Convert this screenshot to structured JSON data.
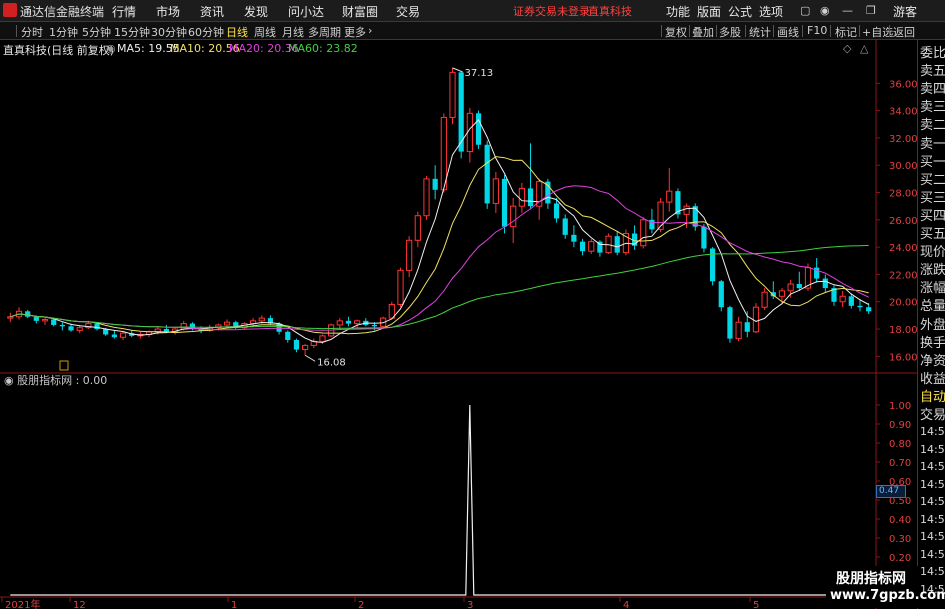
{
  "app": {
    "title": "通达信金融终端"
  },
  "menu": {
    "items": [
      "行情",
      "市场",
      "资讯",
      "发现",
      "问小达",
      "财富圈",
      "交易"
    ],
    "notice": "证券交易未登录",
    "stock_name": "直真科技",
    "right_items": [
      "功能",
      "版面",
      "公式",
      "选项"
    ],
    "guest": "游客"
  },
  "toolbar": {
    "periods": [
      "分时",
      "1分钟",
      "5分钟",
      "15分钟",
      "30分钟",
      "60分钟",
      "日线",
      "周线",
      "月线",
      "多周期",
      "更多"
    ],
    "active_period": "日线",
    "tools": [
      "复权",
      "叠加",
      "多股",
      "统计",
      "画线",
      "F10",
      "标记",
      "+自选",
      "返回"
    ]
  },
  "info": {
    "stock_label": "直真科技(日线 前复权)",
    "ma5": "MA5: 19.55",
    "ma10": "MA10: 20.56",
    "ma20": "MA20: 20.36",
    "ma60": "MA60: 23.82"
  },
  "colors": {
    "up": "#ff3333",
    "down": "#00d8e8",
    "ma5": "#f0f0f0",
    "ma10": "#f0e060",
    "ma20": "#e040e0",
    "ma60": "#40d040",
    "grid": "#8a1515"
  },
  "indicator": {
    "label": "股朋指标网 : 0.00",
    "current_value": "0.47"
  },
  "right_panel": {
    "items": [
      "委比",
      "卖五",
      "卖四",
      "卖三",
      "卖二",
      "卖一",
      "买一",
      "买二",
      "买三",
      "买四",
      "买五",
      "现价",
      "涨跌",
      "涨幅",
      "总量",
      "外盘",
      "换手",
      "净资",
      "收益"
    ],
    "auto": "自动",
    "trade": "交易",
    "times": [
      "14:56",
      "14:56",
      "14:56",
      "14:56",
      "14:56",
      "14:56",
      "14:56",
      "14:56",
      "14:56",
      "14:56"
    ]
  },
  "watermark": {
    "line1": "股朋指标网",
    "line2": "www.7gpzb.com"
  },
  "chart_data": [
    {
      "type": "candlestick",
      "title": "直真科技(日线 前复权)",
      "ylim": [
        15.0,
        38.0
      ],
      "y_ticks": [
        "36.00",
        "34.00",
        "32.00",
        "30.00",
        "28.00",
        "26.00",
        "24.00",
        "22.00",
        "20.00",
        "18.00",
        "16.00"
      ],
      "x_ticks": [
        "2021年",
        "12",
        "1",
        "2",
        "3",
        "4",
        "5"
      ],
      "annotations": {
        "high": "37.13",
        "low": "16.08"
      },
      "candles": [
        [
          18.8,
          19.2,
          18.5,
          18.9
        ],
        [
          18.9,
          19.6,
          18.7,
          19.3
        ],
        [
          19.3,
          19.4,
          18.8,
          18.9
        ],
        [
          18.9,
          19.0,
          18.4,
          18.6
        ],
        [
          18.6,
          18.9,
          18.3,
          18.7
        ],
        [
          18.7,
          18.8,
          18.2,
          18.3
        ],
        [
          18.3,
          18.5,
          17.9,
          18.2
        ],
        [
          18.2,
          18.4,
          17.8,
          17.9
        ],
        [
          17.9,
          18.3,
          17.7,
          18.1
        ],
        [
          18.1,
          18.6,
          18.0,
          18.4
        ],
        [
          18.4,
          18.5,
          17.9,
          18.0
        ],
        [
          18.0,
          18.1,
          17.5,
          17.6
        ],
        [
          17.6,
          17.9,
          17.3,
          17.4
        ],
        [
          17.4,
          17.8,
          17.2,
          17.7
        ],
        [
          17.7,
          17.9,
          17.4,
          17.5
        ],
        [
          17.5,
          17.8,
          17.3,
          17.6
        ],
        [
          17.6,
          17.9,
          17.4,
          17.8
        ],
        [
          17.8,
          18.2,
          17.6,
          18.0
        ],
        [
          18.0,
          18.3,
          17.7,
          17.8
        ],
        [
          17.8,
          18.1,
          17.6,
          18.0
        ],
        [
          18.0,
          18.6,
          17.9,
          18.4
        ],
        [
          18.4,
          18.5,
          17.9,
          18.0
        ],
        [
          18.0,
          18.2,
          17.7,
          17.9
        ],
        [
          17.9,
          18.3,
          17.8,
          18.1
        ],
        [
          18.1,
          18.4,
          17.9,
          18.3
        ],
        [
          18.3,
          18.7,
          18.1,
          18.5
        ],
        [
          18.5,
          18.6,
          18.0,
          18.1
        ],
        [
          18.1,
          18.5,
          18.0,
          18.4
        ],
        [
          18.4,
          18.8,
          18.2,
          18.6
        ],
        [
          18.6,
          19.0,
          18.4,
          18.8
        ],
        [
          18.8,
          19.0,
          18.3,
          18.4
        ],
        [
          18.4,
          18.5,
          17.6,
          17.8
        ],
        [
          17.8,
          17.9,
          17.0,
          17.2
        ],
        [
          17.2,
          17.3,
          16.3,
          16.5
        ],
        [
          16.5,
          16.9,
          16.08,
          16.8
        ],
        [
          16.8,
          17.3,
          16.6,
          17.1
        ],
        [
          17.1,
          17.6,
          16.9,
          17.5
        ],
        [
          17.5,
          18.4,
          17.4,
          18.3
        ],
        [
          18.3,
          18.8,
          18.0,
          18.6
        ],
        [
          18.6,
          18.9,
          18.2,
          18.4
        ],
        [
          18.4,
          18.7,
          18.1,
          18.6
        ],
        [
          18.6,
          18.8,
          18.2,
          18.3
        ],
        [
          18.3,
          18.5,
          17.9,
          18.2
        ],
        [
          18.2,
          18.9,
          18.1,
          18.8
        ],
        [
          18.8,
          20.0,
          18.7,
          19.8
        ],
        [
          19.8,
          22.5,
          19.6,
          22.3
        ],
        [
          22.3,
          24.8,
          21.8,
          24.5
        ],
        [
          24.5,
          26.6,
          24.0,
          26.3
        ],
        [
          26.3,
          29.2,
          26.0,
          29.0
        ],
        [
          29.0,
          30.0,
          27.5,
          28.2
        ],
        [
          28.2,
          33.8,
          28.0,
          33.5
        ],
        [
          33.5,
          37.13,
          33.0,
          36.8
        ],
        [
          36.8,
          36.9,
          30.5,
          31.0
        ],
        [
          31.0,
          34.2,
          30.2,
          33.8
        ],
        [
          33.8,
          34.0,
          31.2,
          31.5
        ],
        [
          31.5,
          31.8,
          26.8,
          27.2
        ],
        [
          27.2,
          29.5,
          26.5,
          29.0
        ],
        [
          29.0,
          29.3,
          25.0,
          25.5
        ],
        [
          25.5,
          27.6,
          24.3,
          27.0
        ],
        [
          27.0,
          28.7,
          26.5,
          28.3
        ],
        [
          28.3,
          31.6,
          26.8,
          27.0
        ],
        [
          27.0,
          29.0,
          26.0,
          28.8
        ],
        [
          28.8,
          29.0,
          26.8,
          27.2
        ],
        [
          27.2,
          27.6,
          25.8,
          26.1
        ],
        [
          26.1,
          26.4,
          24.6,
          24.9
        ],
        [
          24.9,
          25.6,
          24.0,
          24.4
        ],
        [
          24.4,
          24.6,
          23.4,
          23.7
        ],
        [
          23.7,
          24.6,
          23.5,
          24.4
        ],
        [
          24.4,
          24.5,
          23.3,
          23.6
        ],
        [
          23.6,
          25.0,
          23.5,
          24.8
        ],
        [
          24.8,
          25.2,
          23.4,
          23.6
        ],
        [
          23.6,
          25.3,
          23.4,
          25.0
        ],
        [
          25.0,
          25.6,
          23.8,
          24.1
        ],
        [
          24.1,
          26.2,
          23.9,
          26.0
        ],
        [
          26.0,
          26.8,
          25.0,
          25.3
        ],
        [
          25.3,
          27.6,
          25.1,
          27.3
        ],
        [
          27.3,
          29.8,
          26.6,
          28.1
        ],
        [
          28.1,
          28.3,
          26.1,
          26.4
        ],
        [
          26.4,
          27.2,
          25.4,
          27.0
        ],
        [
          27.0,
          27.2,
          25.2,
          25.5
        ],
        [
          25.5,
          25.7,
          23.6,
          23.9
        ],
        [
          23.9,
          24.0,
          21.2,
          21.5
        ],
        [
          21.5,
          21.6,
          19.3,
          19.6
        ],
        [
          19.6,
          19.7,
          17.0,
          17.3
        ],
        [
          17.3,
          18.9,
          17.1,
          18.5
        ],
        [
          18.5,
          19.3,
          17.4,
          17.8
        ],
        [
          17.8,
          19.9,
          17.7,
          19.6
        ],
        [
          19.6,
          21.0,
          19.4,
          20.7
        ],
        [
          20.7,
          21.5,
          20.2,
          20.4
        ],
        [
          20.4,
          21.0,
          19.9,
          20.8
        ],
        [
          20.8,
          21.6,
          20.3,
          21.3
        ],
        [
          21.3,
          22.2,
          20.8,
          21.0
        ],
        [
          21.0,
          22.8,
          20.8,
          22.5
        ],
        [
          22.5,
          23.2,
          21.4,
          21.7
        ],
        [
          21.7,
          22.0,
          20.7,
          21.0
        ],
        [
          21.0,
          21.2,
          19.7,
          20.0
        ],
        [
          20.0,
          20.8,
          19.6,
          20.4
        ],
        [
          20.4,
          20.6,
          19.5,
          19.7
        ],
        [
          19.7,
          20.2,
          19.3,
          19.6
        ],
        [
          19.6,
          19.9,
          19.1,
          19.3
        ]
      ],
      "ma_current": {
        "MA5": 19.55,
        "MA10": 20.56,
        "MA20": 20.36,
        "MA60": 23.82
      }
    },
    {
      "type": "line",
      "title": "股朋指标网",
      "ylim": [
        0.0,
        1.1
      ],
      "y_ticks": [
        "1.00",
        "0.90",
        "0.80",
        "0.70",
        "0.60",
        "0.50",
        "0.40",
        "0.30",
        "0.20",
        "0.10",
        "0.00"
      ],
      "spike_index": 53,
      "spike_value": 1.0
    }
  ]
}
